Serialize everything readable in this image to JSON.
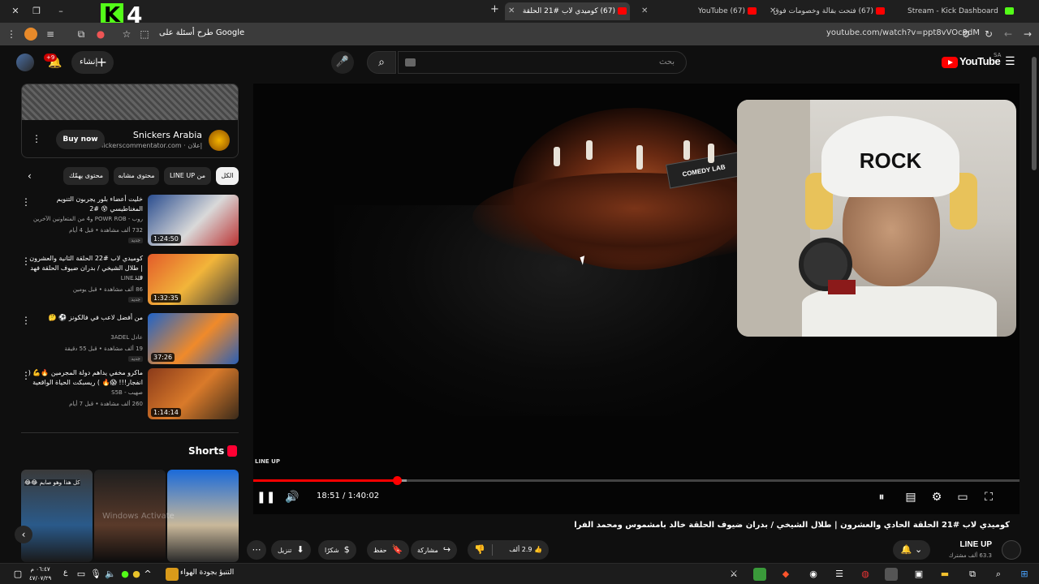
{
  "browser": {
    "tabs": [
      {
        "title": "Stream - Kick Dashboard"
      },
      {
        "title": "(67) فتحت بقالة وخصومات فوق"
      },
      {
        "title": "(67) YouTube"
      },
      {
        "title": "(67) كوميدي لاب #21 الحلقة"
      }
    ],
    "url": "youtube.com/watch?v=ppt8vVOc9dM",
    "ask_google": "طرح أسئلة على Google",
    "overlay_logo": "4"
  },
  "header": {
    "logo_text": "YouTube",
    "country": "SA",
    "search_placeholder": "بحث",
    "create_label": "إنشاء",
    "notif_badge": "+9"
  },
  "ad": {
    "name": "Snickers Arabia",
    "domain": "إعلان · snickerscommentator.com",
    "buy_label": "Buy now"
  },
  "chips": [
    "الكل",
    "من LINE UP",
    "محتوى مشابه",
    "محتوى يهمّك"
  ],
  "related": [
    {
      "title": "خليت أعضاء بلور يجربون التنويم المغناطيسي 😵 #2",
      "channel": "روب - POWR ROB و4 من المتعاونين الآخرين",
      "meta": "732 ألف مشاهدة • قبل 4 أيام",
      "tag": "جديد",
      "duration": "1:24:50"
    },
    {
      "title": "كوميدي لاب #22 الحلقة الثانية والعشرون | طلال الشيخي / بدران ضيوف الحلقة فهد ف...",
      "channel": "LINE UP",
      "meta": "86 ألف مشاهدة • قبل يومين",
      "tag": "جديد",
      "duration": "1:32:35"
    },
    {
      "title": "من أفضل لاعب في فالكونز ⚽ 🤔",
      "channel": "عادل 3ADEL",
      "meta": "19 ألف مشاهدة • قبل 55 دقيقة",
      "tag": "جديد",
      "duration": "37:26"
    },
    {
      "title": "ماكرو مخفي يداهم دولة المجرمين 🔥💪 ( انفجار!!! 😱🔥 ) ريسبكت الحياة الواقعية",
      "channel": "صهيب - S5B",
      "meta": "260 ألف مشاهدة • قبل 7 أيام",
      "tag": "",
      "duration": "1:14:14"
    }
  ],
  "shorts": {
    "title": "Shorts",
    "caption": "كل هذا وهو صايم 😂😂"
  },
  "player": {
    "channel_tag": "LINE UP",
    "time_current": "18:51",
    "time_total": "1:40:02",
    "progress_fraction": 0.188,
    "loaded_fraction": 0.2,
    "stage_sign": "COMEDY LAB",
    "beanie_text": "ROCK"
  },
  "video": {
    "title": "كوميدي لاب #21 الحلقة الحادي والعشرون | طلال الشيخي / بدران ضيوف الحلقة خالد بامشموس ومحمد الفرا",
    "channel": "LINE UP",
    "subscribers": "63.3 ألف مشترك",
    "likes": "2.9 ألف",
    "share": "مشاركة",
    "save": "حفظ",
    "thanks": "شكرًا",
    "download": "تنزيل"
  },
  "taskbar": {
    "weather": "التنبؤ بجودة الهواء",
    "lang": "ع",
    "time": "٠٦:٤٧ م",
    "date": "٤٧/٠٧/٢٩",
    "watermark": "Windows Activate"
  },
  "colors": {
    "accent": "#ff0000",
    "kick": "#53fc18",
    "bg": "#0f0f0f"
  }
}
